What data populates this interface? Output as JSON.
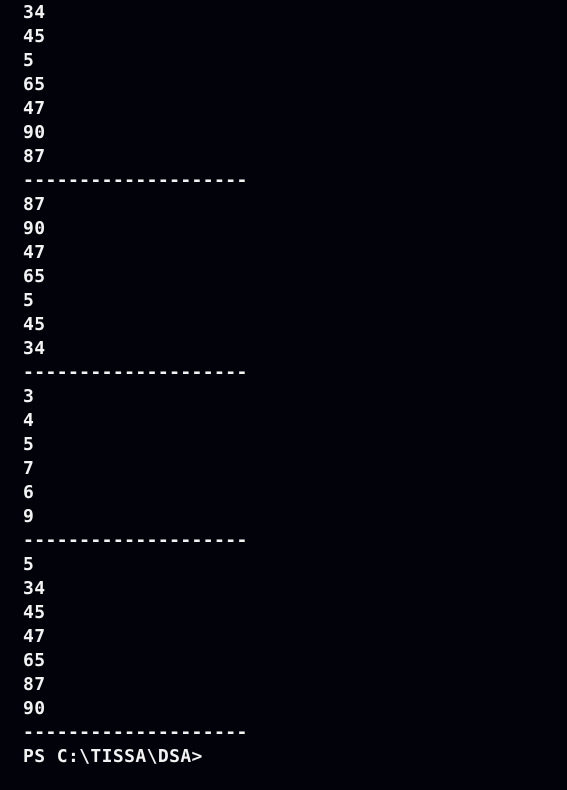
{
  "terminal": {
    "lines": [
      "34",
      "45",
      "5",
      "65",
      "47",
      "90",
      "87",
      "--------------------",
      "87",
      "90",
      "47",
      "65",
      "5",
      "45",
      "34",
      "--------------------",
      "3",
      "4",
      "5",
      "7",
      "6",
      "9",
      "--------------------",
      "5",
      "34",
      "45",
      "47",
      "65",
      "87",
      "90",
      "--------------------"
    ],
    "prompt": "PS C:\\TISSA\\DSA>"
  },
  "colors": {
    "background": "#02030a",
    "foreground": "#f2f2f2"
  }
}
